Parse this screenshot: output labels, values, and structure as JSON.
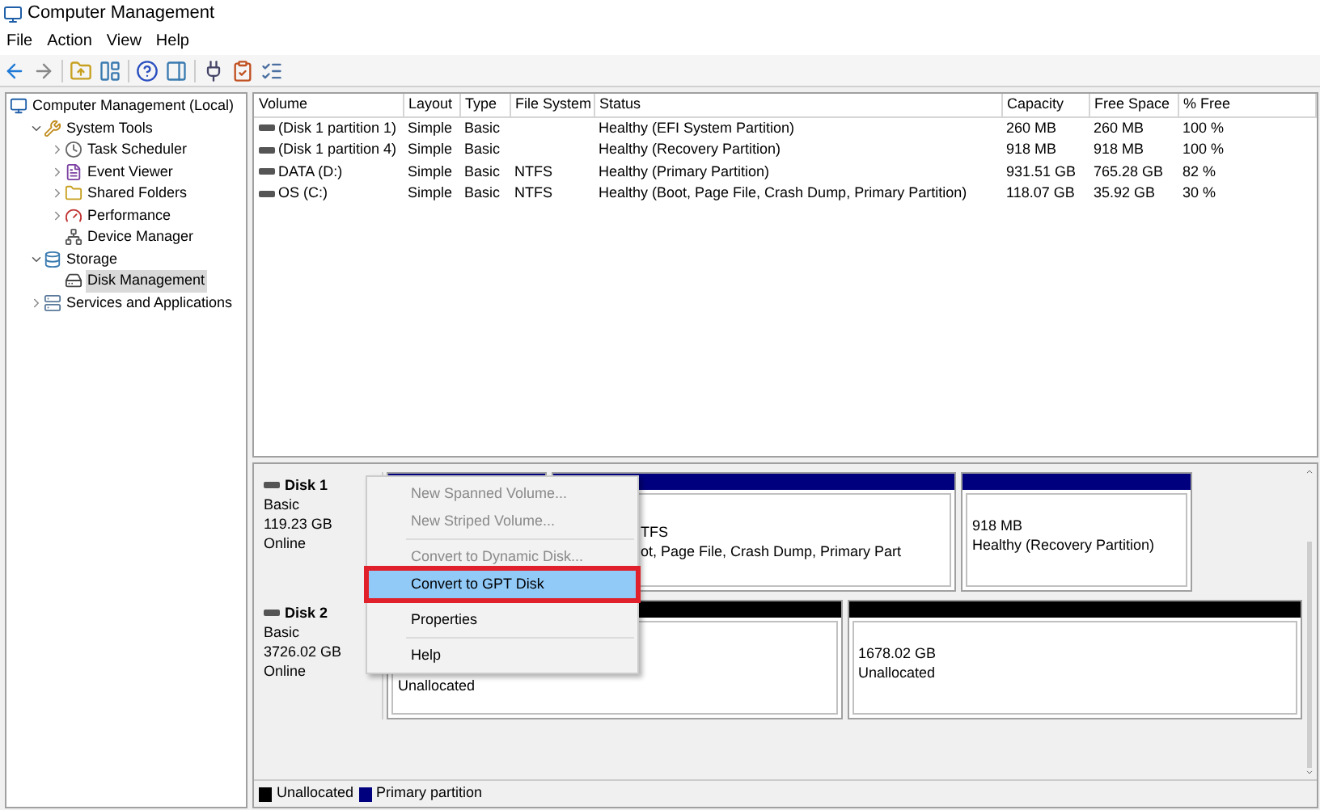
{
  "window": {
    "title": "Computer Management"
  },
  "menu_bar": [
    "File",
    "Action",
    "View",
    "Help"
  ],
  "tree": [
    {
      "label": "Computer Management (Local)",
      "selected": false,
      "children": [
        {
          "label": "System Tools",
          "expanded": true,
          "selected": false,
          "children": [
            {
              "label": "Task Scheduler",
              "expanded": false,
              "selected": false
            },
            {
              "label": "Event Viewer",
              "expanded": false,
              "selected": false
            },
            {
              "label": "Shared Folders",
              "expanded": false,
              "selected": false
            },
            {
              "label": "Performance",
              "expanded": false,
              "selected": false
            },
            {
              "label": "Device Manager",
              "selected": false
            }
          ]
        },
        {
          "label": "Storage",
          "expanded": true,
          "selected": false,
          "children": [
            {
              "label": "Disk Management",
              "selected": true
            }
          ]
        },
        {
          "label": "Services and Applications",
          "expanded": false,
          "selected": false
        }
      ]
    }
  ],
  "volume_table": {
    "columns": [
      "Volume",
      "Layout",
      "Type",
      "File System",
      "Status",
      "Capacity",
      "Free Space",
      "% Free"
    ],
    "rows": [
      [
        "(Disk 1 partition 1)",
        "Simple",
        "Basic",
        "",
        "Healthy (EFI System Partition)",
        "260 MB",
        "260 MB",
        "100 %"
      ],
      [
        "(Disk 1 partition 4)",
        "Simple",
        "Basic",
        "",
        "Healthy (Recovery Partition)",
        "918 MB",
        "918 MB",
        "100 %"
      ],
      [
        "DATA (D:)",
        "Simple",
        "Basic",
        "NTFS",
        "Healthy (Primary Partition)",
        "931.51 GB",
        "765.28 GB",
        "82 %"
      ],
      [
        "OS (C:)",
        "Simple",
        "Basic",
        "NTFS",
        "Healthy (Boot, Page File, Crash Dump, Primary Partition)",
        "118.07 GB",
        "35.92 GB",
        "30 %"
      ]
    ]
  },
  "disks": [
    {
      "name": "Disk 1",
      "type": "Basic",
      "size": "119.23 GB",
      "status": "Online",
      "partitions": [
        {
          "color": "#00007f"
        },
        {
          "color": "#00007f",
          "lines": [
            "TFS",
            "ot, Page File, Crash Dump, Primary Part"
          ]
        },
        {
          "color": "#00007f",
          "lines": [
            "918 MB",
            "Healthy (Recovery Partition)"
          ]
        }
      ]
    },
    {
      "name": "Disk 2",
      "type": "Basic",
      "size": "3726.02 GB",
      "status": "Online",
      "partitions": [
        {
          "color": "#000000",
          "lines": [
            "Unallocated"
          ]
        },
        {
          "color": "#000000",
          "lines": [
            "1678.02 GB",
            "Unallocated"
          ]
        }
      ]
    }
  ],
  "context_menu": [
    {
      "label": "New Spanned Volume...",
      "disabled": true,
      "selected": false,
      "separator_before": false
    },
    {
      "label": "New Striped Volume...",
      "disabled": true,
      "selected": false,
      "separator_before": false
    },
    {
      "label": "Convert to Dynamic Disk...",
      "disabled": true,
      "selected": false,
      "separator_before": true
    },
    {
      "label": "Convert to GPT Disk",
      "disabled": false,
      "selected": true,
      "separator_before": false
    },
    {
      "label": "Properties",
      "disabled": false,
      "selected": false,
      "separator_before": true
    },
    {
      "label": "Help",
      "disabled": false,
      "selected": false,
      "separator_before": true
    }
  ],
  "legend": [
    {
      "label": "Unallocated",
      "color": "#000000"
    },
    {
      "label": "Primary partition",
      "color": "#00007f"
    }
  ]
}
